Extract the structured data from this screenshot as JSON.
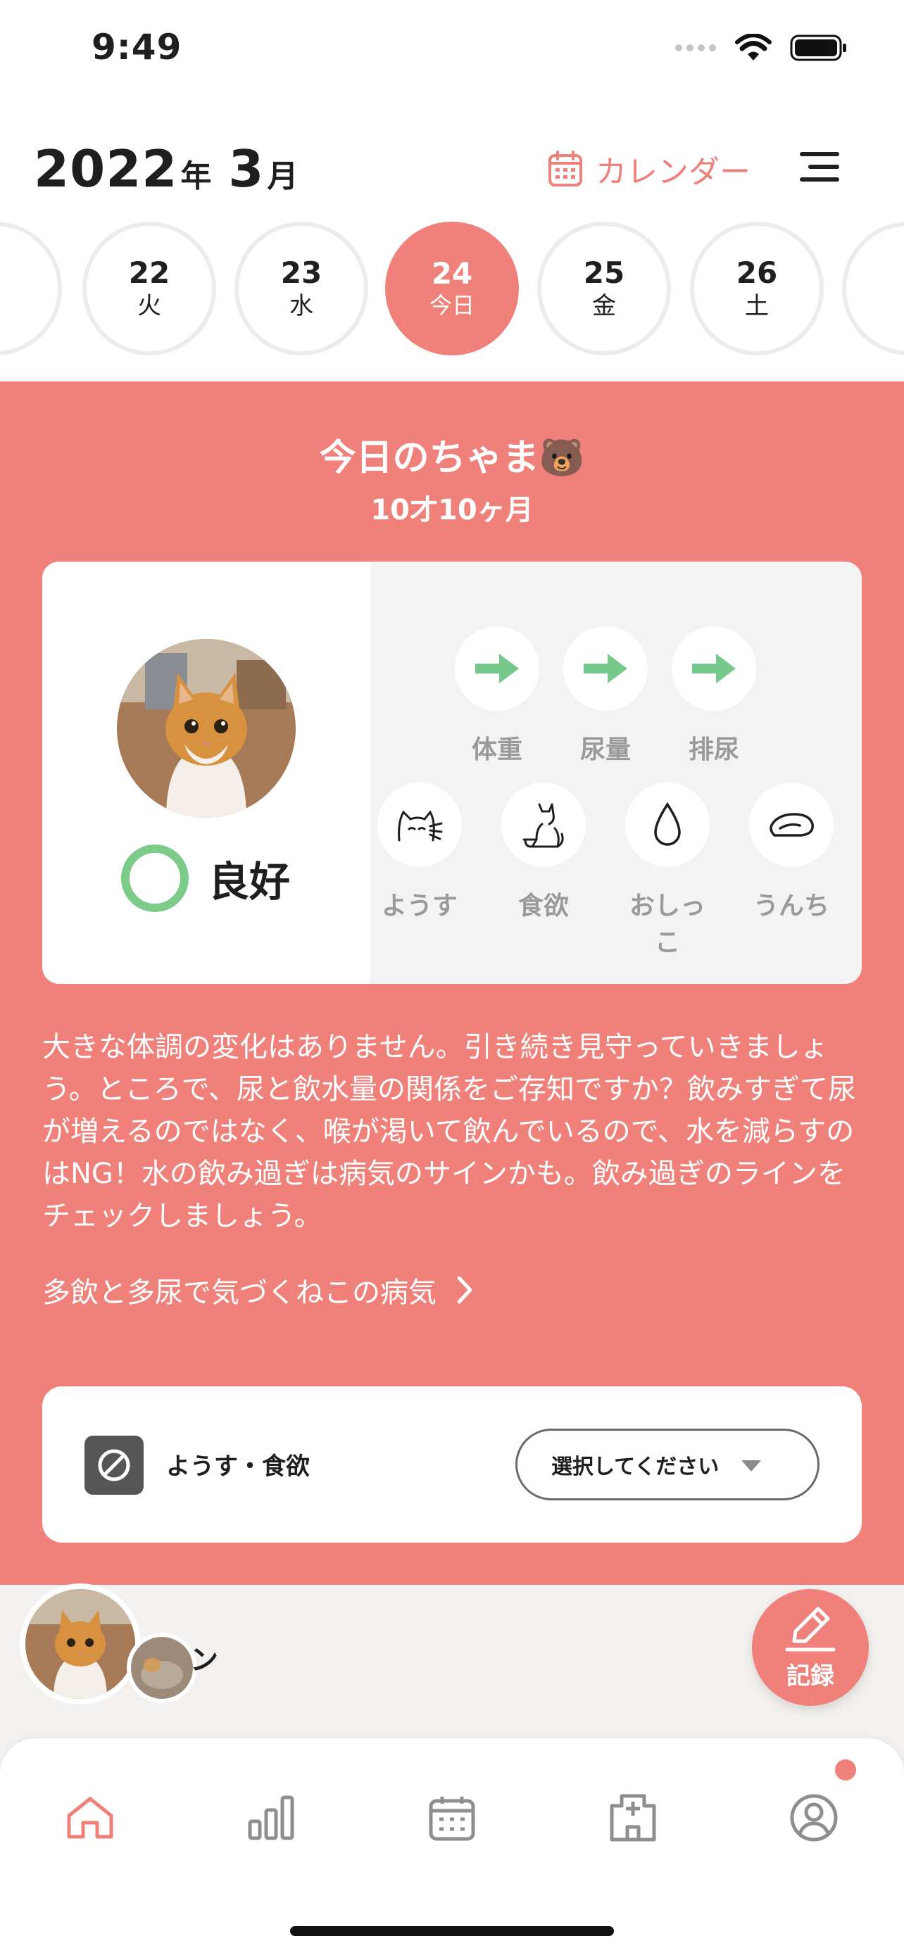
{
  "status_bar": {
    "time": "9:49"
  },
  "header": {
    "year": "2022",
    "year_unit": "年",
    "month": "3",
    "month_unit": "月",
    "calendar_label": "カレンダー"
  },
  "dates": [
    {
      "num": "22",
      "dow": "火",
      "active": false
    },
    {
      "num": "23",
      "dow": "水",
      "active": false
    },
    {
      "num": "24",
      "dow": "今日",
      "active": true
    },
    {
      "num": "25",
      "dow": "金",
      "active": false
    },
    {
      "num": "26",
      "dow": "土",
      "active": false
    }
  ],
  "today": {
    "title": "今日のちゃま🐻",
    "age": "10才10ヶ月",
    "condition": "良好",
    "trends": [
      {
        "label": "体重",
        "icon": "arrow-right-icon"
      },
      {
        "label": "尿量",
        "icon": "arrow-right-icon"
      },
      {
        "label": "排尿",
        "icon": "arrow-right-icon"
      }
    ],
    "observations": [
      {
        "label": "ようす",
        "icon": "cat-face-icon"
      },
      {
        "label": "食欲",
        "icon": "cat-sitting-icon"
      },
      {
        "label": "おしっこ",
        "icon": "drop-icon"
      },
      {
        "label": "うんち",
        "icon": "poop-icon"
      }
    ],
    "advice": "大きな体調の変化はありません。引き続き見守っていきましょう。ところで、尿と飲水量の関係をご存知ですか？飲みすぎて尿が増えるのではなく、喉が渇いて飲んでいるので、水を減らすのはNG！水の飲み過ぎは病気のサインかも。飲み過ぎのラインをチェックしましょう。",
    "link_label": "多飲と多尿で気づくねこの病気"
  },
  "select_card": {
    "label": "ようす・食欲",
    "placeholder": "選択してください"
  },
  "pet_switch": {
    "name": "ン"
  },
  "fab": {
    "label": "記録"
  },
  "tabs": [
    "home-icon",
    "chart-icon",
    "calendar-icon",
    "hospital-icon",
    "profile-icon"
  ],
  "colors": {
    "accent": "#ef807a",
    "good": "#7dcb88",
    "arrow": "#76c98a"
  }
}
